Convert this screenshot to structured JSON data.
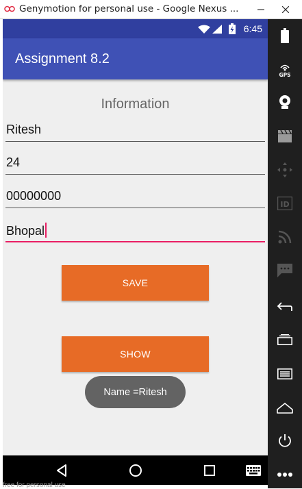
{
  "window": {
    "title": "Genymotion for personal use - Google Nexus ...",
    "footer": "free for personal use"
  },
  "status_bar": {
    "time": "6:45"
  },
  "app_bar": {
    "title": "Assignment 8.2"
  },
  "form": {
    "heading": "Information",
    "fields": [
      {
        "value": "Ritesh"
      },
      {
        "value": "24"
      },
      {
        "value": "00000000"
      },
      {
        "value": "Bhopal"
      }
    ],
    "save_label": "SAVE",
    "show_label": "SHOW"
  },
  "toast": {
    "text": "Name =Ritesh"
  },
  "colors": {
    "status_bar": "#303f9f",
    "app_bar": "#3f51b5",
    "button": "#e76b26",
    "focus_line": "#e91e63",
    "side_panel": "#1f1f1f"
  },
  "icons": {
    "side_panel": [
      "battery-icon",
      "gps-icon",
      "webcam-icon",
      "media-icon",
      "dpad-icon",
      "id-icon",
      "rss-icon",
      "sms-icon",
      "back-icon",
      "recents-icon",
      "menu-icon",
      "home-icon",
      "power-icon"
    ],
    "nav_bar": [
      "back-icon",
      "home-icon",
      "recents-icon",
      "keyboard-icon",
      "more-icon"
    ]
  }
}
